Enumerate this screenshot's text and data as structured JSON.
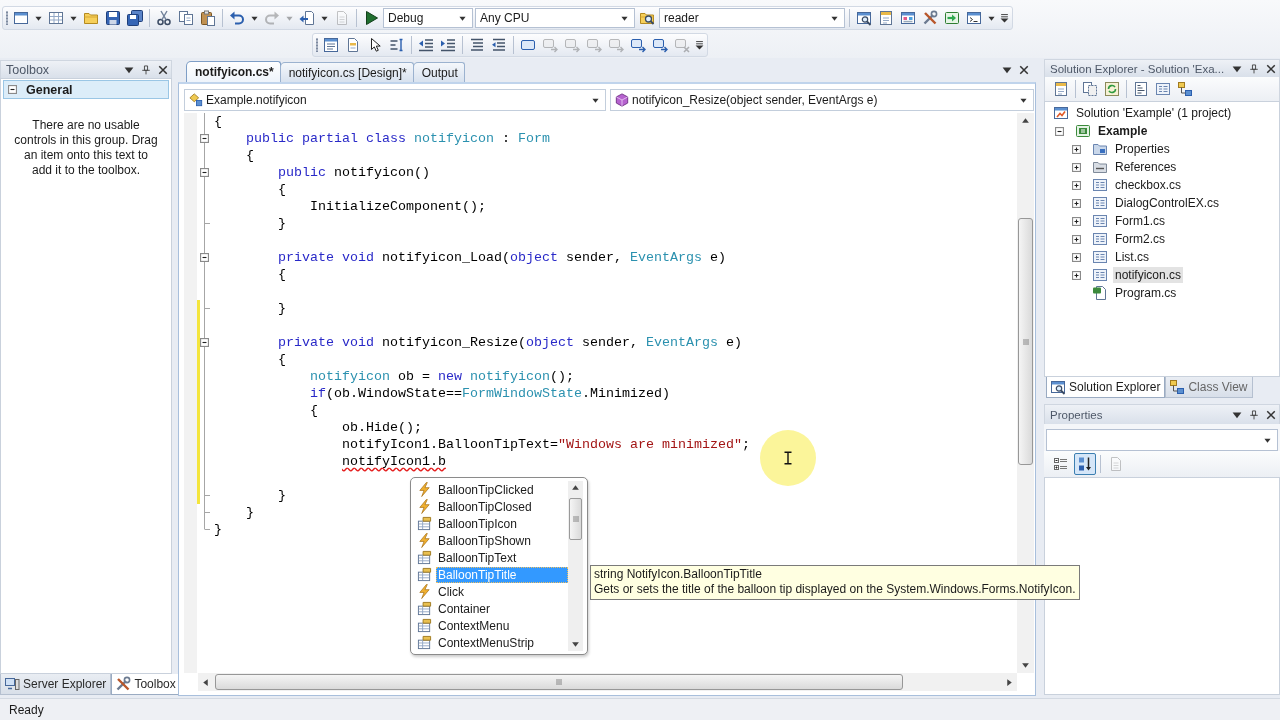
{
  "toolbars": [
    {
      "items": [
        {
          "kind": "new-project",
          "disabled": false,
          "dropdown": true
        },
        {
          "kind": "add-item",
          "disabled": false,
          "dropdown": true
        },
        {
          "kind": "open",
          "disabled": false,
          "dropdown": false
        },
        {
          "kind": "save",
          "disabled": false,
          "dropdown": false
        },
        {
          "kind": "save-all",
          "disabled": false,
          "dropdown": false
        },
        {
          "kind": "separator"
        },
        {
          "kind": "cut",
          "disabled": false,
          "dropdown": false
        },
        {
          "kind": "copy",
          "disabled": false,
          "dropdown": false
        },
        {
          "kind": "paste",
          "disabled": false,
          "dropdown": false
        },
        {
          "kind": "separator"
        },
        {
          "kind": "undo",
          "disabled": false,
          "dropdown": true
        },
        {
          "kind": "redo",
          "disabled": true,
          "dropdown": true
        },
        {
          "kind": "navigate-back",
          "disabled": false,
          "dropdown": true
        },
        {
          "kind": "navigate-forward",
          "disabled": true,
          "dropdown": false
        },
        {
          "kind": "separator"
        },
        {
          "kind": "start",
          "disabled": false,
          "dropdown": false
        },
        {
          "kind": "combo",
          "value": "Debug"
        },
        {
          "kind": "combo",
          "value": "Any CPU"
        },
        {
          "kind": "find-in-files",
          "disabled": false,
          "dropdown": false
        },
        {
          "kind": "combo",
          "value": "reader"
        },
        {
          "kind": "separator"
        },
        {
          "kind": "solution-explorer",
          "disabled": false,
          "dropdown": false
        },
        {
          "kind": "properties-window",
          "disabled": false,
          "dropdown": false
        },
        {
          "kind": "object-browser",
          "disabled": false,
          "dropdown": false
        },
        {
          "kind": "toolbox",
          "disabled": false,
          "dropdown": false
        },
        {
          "kind": "start-page",
          "disabled": false,
          "dropdown": false
        },
        {
          "kind": "command-window",
          "disabled": false,
          "dropdown": true
        }
      ]
    },
    {
      "items": [
        {
          "kind": "member-list",
          "disabled": false,
          "dropdown": false
        },
        {
          "kind": "parameter-info",
          "disabled": false,
          "dropdown": false
        },
        {
          "kind": "quick-info",
          "disabled": false,
          "dropdown": false
        },
        {
          "kind": "word-completion",
          "disabled": false,
          "dropdown": false
        },
        {
          "kind": "separator"
        },
        {
          "kind": "outdent",
          "disabled": false,
          "dropdown": false
        },
        {
          "kind": "indent",
          "disabled": false,
          "dropdown": false
        },
        {
          "kind": "separator"
        },
        {
          "kind": "comment",
          "disabled": false,
          "dropdown": false
        },
        {
          "kind": "uncomment",
          "disabled": false,
          "dropdown": false
        },
        {
          "kind": "separator"
        },
        {
          "kind": "bookmark",
          "disabled": false,
          "dropdown": false
        },
        {
          "kind": "previous-bookmark",
          "disabled": true,
          "dropdown": false
        },
        {
          "kind": "next-bookmark",
          "disabled": true,
          "dropdown": false
        },
        {
          "kind": "previous-bookmark-in-folder",
          "disabled": true,
          "dropdown": false
        },
        {
          "kind": "next-bookmark-in-folder",
          "disabled": true,
          "dropdown": false
        },
        {
          "kind": "previous-bookmark-in-document",
          "disabled": false,
          "dropdown": false
        },
        {
          "kind": "next-bookmark-in-document",
          "disabled": false,
          "dropdown": false
        },
        {
          "kind": "clear-bookmarks",
          "disabled": true,
          "dropdown": false
        }
      ]
    }
  ],
  "toolbox": {
    "title": "Toolbox",
    "group": {
      "label": "General",
      "expanded": true
    },
    "message": "There are no usable controls in this group. Drag an item onto this text to add it to the toolbox.",
    "tabs": [
      {
        "label": "Server Explorer",
        "kind": "server-explorer",
        "selected": false
      },
      {
        "label": "Toolbox",
        "kind": "toolbox",
        "selected": true
      }
    ]
  },
  "editor": {
    "tabs": [
      {
        "label": "notifyicon.cs*",
        "selected": true
      },
      {
        "label": "notifyicon.cs [Design]*",
        "selected": false
      },
      {
        "label": "Output",
        "selected": false
      }
    ],
    "type_combo": "Example.notifyicon",
    "member_combo": "notifyicon_Resize(object sender, EventArgs e)",
    "code": {
      "lines": [
        {
          "kind": "code",
          "fold_start": false,
          "fold_end": false,
          "changed": false,
          "tokens": [
            {
              "kind": "plain",
              "text": "{"
            }
          ],
          "children": [
            {
              "kind": "code",
              "fold_start": true,
              "fold_end": false,
              "changed": false,
              "tokens": [
                {
                  "kind": "keyword",
                  "text": "public partial class "
                },
                {
                  "kind": "type",
                  "text": "notifyicon"
                },
                {
                  "kind": "plain",
                  "text": " : "
                },
                {
                  "kind": "type",
                  "text": "Form"
                }
              ]
            },
            {
              "kind": "code",
              "fold_start": false,
              "fold_end": false,
              "changed": false,
              "tokens": [
                {
                  "kind": "plain",
                  "text": "{"
                }
              ],
              "children": [
                {
                  "kind": "code",
                  "fold_start": true,
                  "fold_end": false,
                  "changed": false,
                  "tokens": [
                    {
                      "kind": "keyword",
                      "text": "public "
                    },
                    {
                      "kind": "plain",
                      "text": "notifyicon()"
                    }
                  ]
                },
                {
                  "kind": "code",
                  "fold_start": false,
                  "fold_end": false,
                  "changed": false,
                  "tokens": [
                    {
                      "kind": "plain",
                      "text": "{"
                    }
                  ],
                  "children": [
                    {
                      "kind": "code",
                      "fold_start": false,
                      "fold_end": false,
                      "changed": false,
                      "tokens": [
                        {
                          "kind": "plain",
                          "text": "InitializeComponent();"
                        }
                      ]
                    }
                  ]
                },
                {
                  "kind": "code",
                  "fold_start": false,
                  "fold_end": true,
                  "changed": false,
                  "tokens": [
                    {
                      "kind": "plain",
                      "text": "}"
                    }
                  ]
                },
                {
                  "kind": "blank",
                  "changed": false
                },
                {
                  "kind": "code",
                  "fold_start": true,
                  "fold_end": false,
                  "changed": false,
                  "tokens": [
                    {
                      "kind": "keyword",
                      "text": "private void "
                    },
                    {
                      "kind": "plain",
                      "text": "notifyicon_Load("
                    },
                    {
                      "kind": "keyword",
                      "text": "object "
                    },
                    {
                      "kind": "plain",
                      "text": "sender, "
                    },
                    {
                      "kind": "type",
                      "text": "EventArgs"
                    },
                    {
                      "kind": "plain",
                      "text": " e)"
                    }
                  ]
                },
                {
                  "kind": "code",
                  "fold_start": false,
                  "fold_end": false,
                  "changed": false,
                  "tokens": [
                    {
                      "kind": "plain",
                      "text": "{"
                    }
                  ],
                  "children": [
                    {
                      "kind": "blank",
                      "changed": false
                    }
                  ]
                },
                {
                  "kind": "code",
                  "fold_start": false,
                  "fold_end": true,
                  "changed": true,
                  "tokens": [
                    {
                      "kind": "plain",
                      "text": "}"
                    }
                  ]
                },
                {
                  "kind": "blank",
                  "changed": true
                },
                {
                  "kind": "code",
                  "fold_start": true,
                  "fold_end": false,
                  "changed": true,
                  "tokens": [
                    {
                      "kind": "keyword",
                      "text": "private void "
                    },
                    {
                      "kind": "plain",
                      "text": "notifyicon_Resize("
                    },
                    {
                      "kind": "keyword",
                      "text": "object "
                    },
                    {
                      "kind": "plain",
                      "text": "sender, "
                    },
                    {
                      "kind": "type",
                      "text": "EventArgs"
                    },
                    {
                      "kind": "plain",
                      "text": " e)"
                    }
                  ]
                },
                {
                  "kind": "code",
                  "fold_start": false,
                  "fold_end": false,
                  "changed": true,
                  "tokens": [
                    {
                      "kind": "plain",
                      "text": "{"
                    }
                  ],
                  "children": [
                    {
                      "kind": "code",
                      "fold_start": false,
                      "fold_end": false,
                      "changed": true,
                      "tokens": [
                        {
                          "kind": "type",
                          "text": "notifyicon"
                        },
                        {
                          "kind": "plain",
                          "text": " ob = "
                        },
                        {
                          "kind": "keyword",
                          "text": "new "
                        },
                        {
                          "kind": "type",
                          "text": "notifyicon"
                        },
                        {
                          "kind": "plain",
                          "text": "();"
                        }
                      ]
                    },
                    {
                      "kind": "code",
                      "fold_start": false,
                      "fold_end": false,
                      "changed": true,
                      "tokens": [
                        {
                          "kind": "keyword",
                          "text": "if"
                        },
                        {
                          "kind": "plain",
                          "text": "(ob.WindowState=="
                        },
                        {
                          "kind": "type",
                          "text": "FormWindowState"
                        },
                        {
                          "kind": "plain",
                          "text": ".Minimized)"
                        }
                      ]
                    },
                    {
                      "kind": "code",
                      "fold_start": false,
                      "fold_end": false,
                      "changed": true,
                      "tokens": [
                        {
                          "kind": "plain",
                          "text": "{"
                        }
                      ],
                      "children": [
                        {
                          "kind": "code",
                          "fold_start": false,
                          "fold_end": false,
                          "changed": true,
                          "tokens": [
                            {
                              "kind": "plain",
                              "text": "ob.Hide();"
                            }
                          ]
                        },
                        {
                          "kind": "code",
                          "fold_start": false,
                          "fold_end": false,
                          "changed": true,
                          "tokens": [
                            {
                              "kind": "plain",
                              "text": "notifyIcon1.BalloonTipText="
                            },
                            {
                              "kind": "string",
                              "text": "\"Windows are minimized\""
                            },
                            {
                              "kind": "plain",
                              "text": ";"
                            }
                          ]
                        },
                        {
                          "kind": "code",
                          "fold_start": false,
                          "fold_end": false,
                          "changed": true,
                          "tokens": [
                            {
                              "kind": "error",
                              "text": "notifyIcon1.b"
                            }
                          ]
                        },
                        {
                          "kind": "blank",
                          "changed": true
                        }
                      ]
                    }
                  ]
                },
                {
                  "kind": "code",
                  "fold_start": false,
                  "fold_end": true,
                  "changed": true,
                  "tokens": [
                    {
                      "kind": "plain",
                      "text": "}"
                    }
                  ]
                }
              ]
            },
            {
              "kind": "code",
              "fold_start": false,
              "fold_end": true,
              "changed": false,
              "tokens": [
                {
                  "kind": "plain",
                  "text": "}"
                }
              ]
            }
          ]
        },
        {
          "kind": "code",
          "fold_start": false,
          "fold_end": true,
          "changed": false,
          "tokens": [
            {
              "kind": "plain",
              "text": "}"
            }
          ]
        }
      ]
    },
    "completion": {
      "items": [
        {
          "label": "BalloonTipClicked",
          "kind": "event",
          "selected": false
        },
        {
          "label": "BalloonTipClosed",
          "kind": "event",
          "selected": false
        },
        {
          "label": "BalloonTipIcon",
          "kind": "property",
          "selected": false
        },
        {
          "label": "BalloonTipShown",
          "kind": "event",
          "selected": false
        },
        {
          "label": "BalloonTipText",
          "kind": "property",
          "selected": false
        },
        {
          "label": "BalloonTipTitle",
          "kind": "property",
          "selected": true
        },
        {
          "label": "Click",
          "kind": "event",
          "selected": false
        },
        {
          "label": "Container",
          "kind": "property",
          "selected": false
        },
        {
          "label": "ContextMenu",
          "kind": "property",
          "selected": false
        },
        {
          "label": "ContextMenuStrip",
          "kind": "property",
          "selected": false
        }
      ]
    },
    "tooltip": {
      "signature": "string NotifyIcon.BalloonTipTitle",
      "description": "Gets or sets the title of the balloon tip displayed on the System.Windows.Forms.NotifyIcon."
    }
  },
  "solution_explorer": {
    "title": "Solution Explorer - Solution 'Exa...",
    "toolbar": [
      {
        "kind": "properties"
      },
      {
        "kind": "separator"
      },
      {
        "kind": "show-all-files"
      },
      {
        "kind": "refresh"
      },
      {
        "kind": "separator"
      },
      {
        "kind": "view-code"
      },
      {
        "kind": "view-designer"
      },
      {
        "kind": "class-diagram"
      }
    ],
    "tree": [
      {
        "label": "Solution 'Example' (1 project)",
        "kind": "solution",
        "expandable": false,
        "selected": false,
        "children": [
          {
            "label": "Example",
            "kind": "project",
            "expandable": true,
            "expanded": true,
            "selected": false,
            "children": [
              {
                "label": "Properties",
                "kind": "properties-folder",
                "expandable": true,
                "expanded": false,
                "selected": false
              },
              {
                "label": "References",
                "kind": "references",
                "expandable": true,
                "expanded": false,
                "selected": false
              },
              {
                "label": "checkbox.cs",
                "kind": "form",
                "expandable": true,
                "expanded": false,
                "selected": false
              },
              {
                "label": "DialogControlEX.cs",
                "kind": "form",
                "expandable": true,
                "expanded": false,
                "selected": false
              },
              {
                "label": "Form1.cs",
                "kind": "form",
                "expandable": true,
                "expanded": false,
                "selected": false
              },
              {
                "label": "Form2.cs",
                "kind": "form",
                "expandable": true,
                "expanded": false,
                "selected": false
              },
              {
                "label": "List.cs",
                "kind": "form",
                "expandable": true,
                "expanded": false,
                "selected": false
              },
              {
                "label": "notifyicon.cs",
                "kind": "form",
                "expandable": true,
                "expanded": false,
                "selected": true
              },
              {
                "label": "Program.cs",
                "kind": "code-file",
                "expandable": false,
                "selected": false
              }
            ]
          }
        ]
      }
    ],
    "tabs": [
      {
        "label": "Solution Explorer",
        "kind": "solution-explorer",
        "selected": true
      },
      {
        "label": "Class View",
        "kind": "class-view",
        "selected": false
      }
    ]
  },
  "properties": {
    "title": "Properties",
    "toolbar": [
      {
        "kind": "categorized",
        "selected": false,
        "disabled": false
      },
      {
        "kind": "alphabetical",
        "selected": true,
        "disabled": false
      },
      {
        "kind": "separator"
      },
      {
        "kind": "property-pages",
        "selected": false,
        "disabled": true
      }
    ]
  },
  "status_bar": {
    "text": "Ready"
  }
}
